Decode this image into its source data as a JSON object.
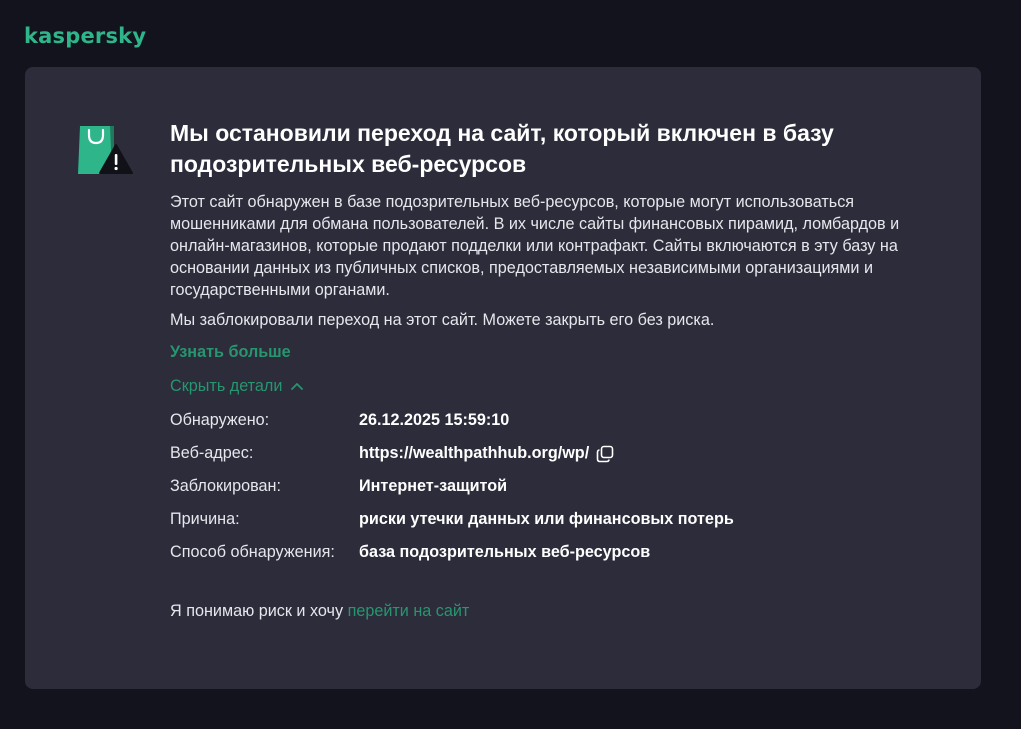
{
  "brand": {
    "logo_text": "kaspersky",
    "accent_color": "#2fb58a",
    "link_color": "#27966f"
  },
  "alert": {
    "icon": "shopping-bag-warning-icon",
    "title": "Мы остановили переход на сайт, который включен в базу подозрительных веб-ресурсов",
    "description": "Этот сайт обнаружен в базе подозрительных веб-ресурсов, которые могут использоваться мошенниками для обмана пользователей. В их числе сайты финансовых пирамид, ломбардов и онлайн-магазинов, которые продают подделки или контрафакт. Сайты включаются в эту базу на основании данных из публичных списков, предоставляемых независимыми организациями и государственными органами.",
    "blocked_note": "Мы заблокировали переход на этот сайт. Можете закрыть его без риска.",
    "learn_more": "Узнать больше",
    "hide_details": "Скрыть детали"
  },
  "details": [
    {
      "label": "Обнаружено:",
      "value": "26.12.2025 15:59:10"
    },
    {
      "label": "Веб-адрес:",
      "value": "https://wealthpathhub.org/wp/"
    },
    {
      "label": "Заблокирован:",
      "value": "Интернет-защитой"
    },
    {
      "label": "Причина:",
      "value": "риски утечки данных или финансовых потерь"
    },
    {
      "label": "Способ обнаружения:",
      "value": "база подозрительных веб-ресурсов"
    }
  ],
  "risk": {
    "prefix": "Я понимаю риск и хочу",
    "link": "перейти на сайт"
  }
}
